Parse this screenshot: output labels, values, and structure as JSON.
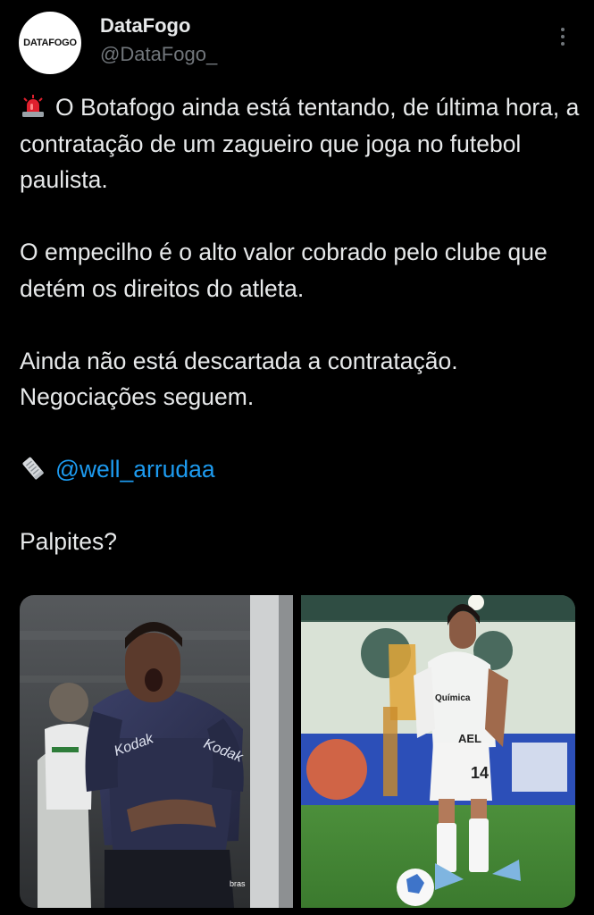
{
  "tweet": {
    "author": {
      "display_name": "DataFogo",
      "handle": "@DataFogo_",
      "avatar_text": "DATAFOGO"
    },
    "paragraphs": [
      {
        "emoji": "police-siren-icon",
        "text": "O Botafogo ainda está tentando, de última hora, a contratação de um zagueiro que joga no futebol paulista."
      },
      {
        "text": "O empecilho é o alto valor cobrado pelo clube que detém os direitos do atleta."
      },
      {
        "text": "Ainda não está descartada a contratação. Negociações seguem."
      },
      {
        "emoji": "newspaper-icon",
        "mention": "@well_arrudaa"
      },
      {
        "text": "Palpites?"
      }
    ],
    "media": [
      {
        "name": "santos-player-photo"
      },
      {
        "name": "corinthians-player-photo"
      }
    ]
  },
  "colors": {
    "background": "#000000",
    "text": "#e7e9ea",
    "secondary_text": "#71767b",
    "link": "#1d9bf0"
  }
}
